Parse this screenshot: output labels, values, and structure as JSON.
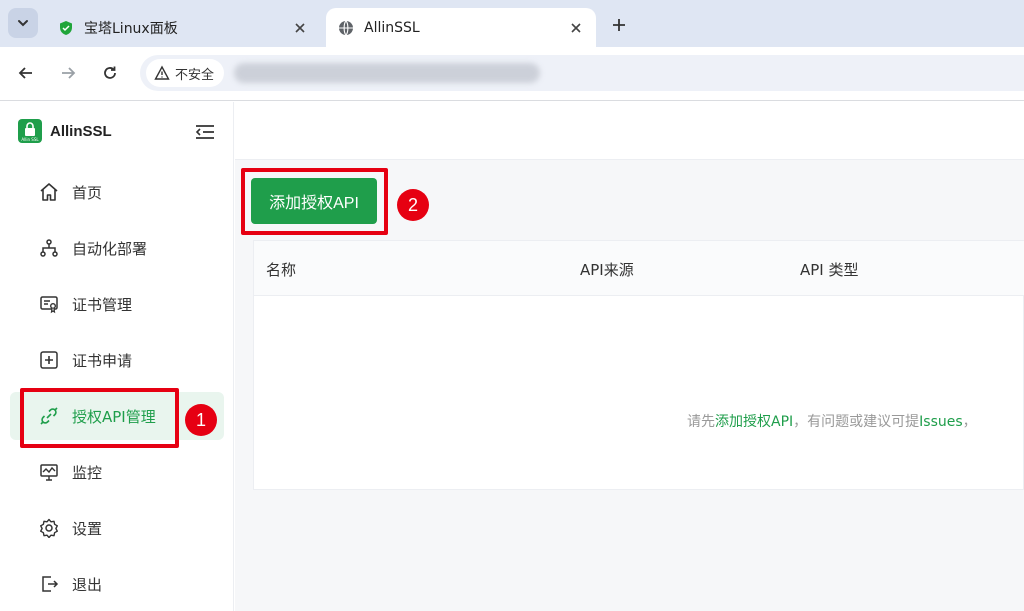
{
  "browser": {
    "tabs": [
      {
        "title": "宝塔Linux面板",
        "favicon": "bt-shield-icon",
        "active": false
      },
      {
        "title": "AllinSSL",
        "favicon": "globe-icon",
        "active": true
      }
    ],
    "security_label": "不安全"
  },
  "app": {
    "brand": "AllinSSL",
    "logo_text": "Allin SSL",
    "accent_color": "#1f9e4b",
    "menu": [
      {
        "label": "首页",
        "icon": "home-icon"
      },
      {
        "label": "自动化部署",
        "icon": "workflow-icon"
      },
      {
        "label": "证书管理",
        "icon": "certificate-icon"
      },
      {
        "label": "证书申请",
        "icon": "plus-square-icon"
      },
      {
        "label": "授权API管理",
        "icon": "api-link-icon",
        "active": true
      },
      {
        "label": "监控",
        "icon": "monitor-icon"
      },
      {
        "label": "设置",
        "icon": "gear-icon"
      },
      {
        "label": "退出",
        "icon": "logout-icon"
      }
    ]
  },
  "main": {
    "add_button": "添加授权API",
    "columns": [
      "名称",
      "API来源",
      "API 类型"
    ],
    "empty": {
      "prefix": "请先",
      "link1": "添加授权API",
      "middle": "，有问题或建议可提",
      "link2": "Issues",
      "suffix": "，"
    }
  },
  "annotations": {
    "badge1": "1",
    "badge2": "2",
    "highlight_color": "#e60012"
  }
}
